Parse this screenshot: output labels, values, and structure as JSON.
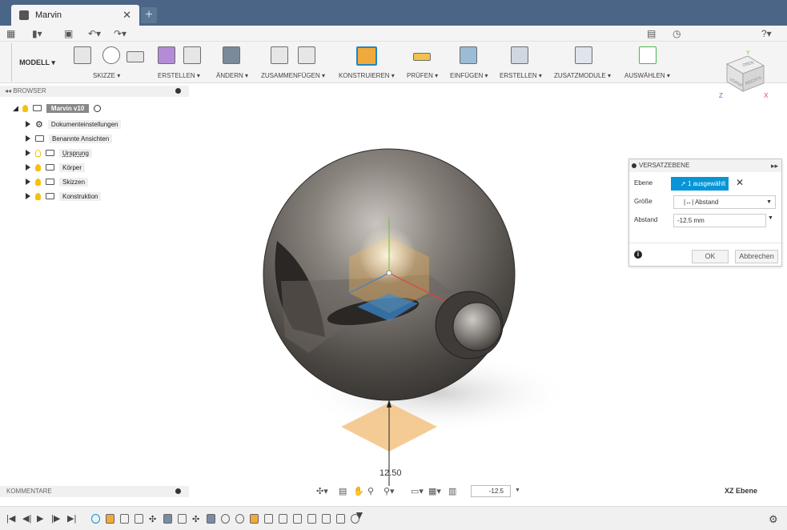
{
  "window": {
    "tab_title": "Marvin",
    "new_tab": "+"
  },
  "toolbar": {
    "workspace": "MODELL ▾",
    "groups": [
      {
        "label": "SKIZZE ▾"
      },
      {
        "label": "ERSTELLEN ▾"
      },
      {
        "label": "ÄNDERN ▾"
      },
      {
        "label": "ZUSAMMENFÜGEN ▾"
      },
      {
        "label": "KONSTRUIEREN ▾"
      },
      {
        "label": "PRÜFEN ▾"
      },
      {
        "label": "EINFÜGEN ▾"
      },
      {
        "label": "ERSTELLEN ▾"
      },
      {
        "label": "ZUSATZMODULE ▾"
      },
      {
        "label": "AUSWÄHLEN ▾"
      }
    ]
  },
  "viewcube": {
    "top": "OBEN",
    "front": "VORNE",
    "right": "RECHTS",
    "axis_y": "Y",
    "axis_z": "Z",
    "axis_x": "X"
  },
  "browser": {
    "title": "BROWSER",
    "root": "Marvin v10",
    "items": [
      {
        "label": "Dokumenteinstellungen"
      },
      {
        "label": "Benannte Ansichten"
      },
      {
        "label": "Ursprung"
      },
      {
        "label": "Körper"
      },
      {
        "label": "Skizzen"
      },
      {
        "label": "Konstruktion"
      }
    ]
  },
  "panel": {
    "title": "VERSATZEBENE",
    "rows": {
      "ebene_label": "Ebene",
      "ebene_value": "1 ausgewählt",
      "groesse_label": "Größe",
      "groesse_value": "Abstand",
      "abstand_label": "Abstand",
      "abstand_value": "-12.5 mm"
    },
    "ok": "OK",
    "cancel": "Abbrechen"
  },
  "viewport": {
    "dimension": "12.50",
    "status": "XZ Ebene"
  },
  "comments": {
    "title": "KOMMENTARE"
  },
  "navbar": {
    "input_value": "-12.5"
  },
  "colors": {
    "accent": "#0696d7",
    "tabbar": "#4a6585"
  }
}
